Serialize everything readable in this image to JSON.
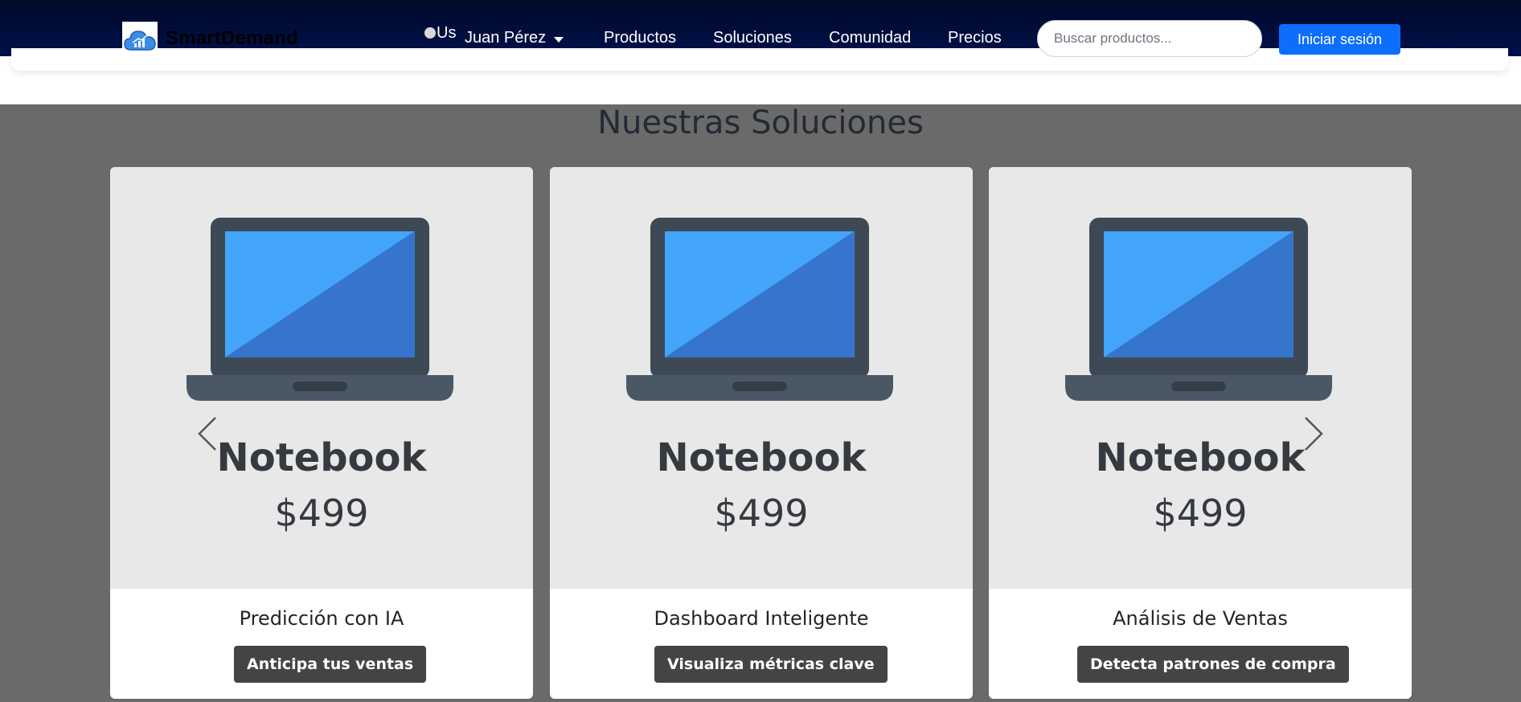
{
  "navbar": {
    "brand": "SmartDemand",
    "user_img_alt": "Us",
    "user_name": "Juan Pérez",
    "links": [
      "Productos",
      "Soluciones",
      "Comunidad",
      "Precios"
    ],
    "search_placeholder": "Buscar productos...",
    "login_label": "Iniciar sesión"
  },
  "section": {
    "title": "Nuestras Soluciones",
    "cards": [
      {
        "image_title": "Notebook",
        "image_price": "$499",
        "title": "Predicción con IA",
        "button": "Anticipa tus ventas"
      },
      {
        "image_title": "Notebook",
        "image_price": "$499",
        "title": "Dashboard Inteligente",
        "button": "Visualiza métricas clave"
      },
      {
        "image_title": "Notebook",
        "image_price": "$499",
        "title": "Análisis de Ventas",
        "button": "Detecta patrones de compra"
      }
    ]
  },
  "icons": {
    "logo": "cloud-chart-icon",
    "prev": "chevron-left-icon",
    "next": "chevron-right-icon",
    "caret": "caret-down-icon"
  },
  "colors": {
    "navbar": "#01104a",
    "primary": "#0d6efd",
    "section_bg": "#6a6a6a",
    "laptop_screen_light": "#42a5fa",
    "laptop_screen_dark": "#3575cd"
  }
}
